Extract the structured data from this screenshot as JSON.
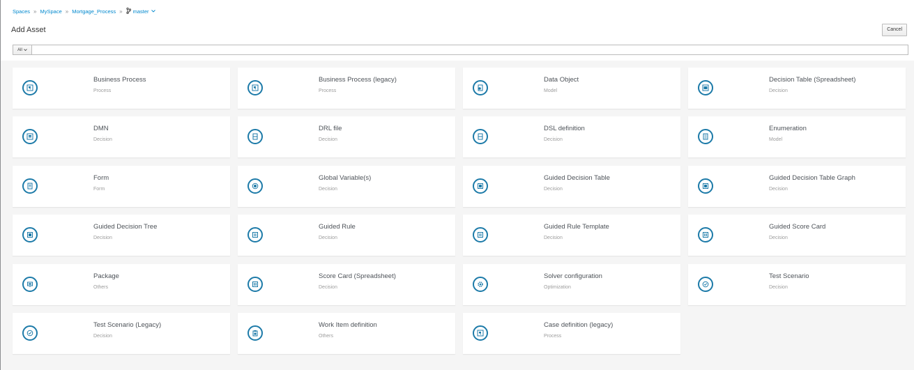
{
  "breadcrumb": {
    "items": [
      "Spaces",
      "MySpace",
      "Mortgage_Process"
    ],
    "separator": "»",
    "branch": "master"
  },
  "title": "Add Asset",
  "cancel_label": "Cancel",
  "filter": {
    "select_value": "All",
    "input_value": ""
  },
  "accent_color": "#1c7aa8",
  "link_color": "#0088ce",
  "assets": [
    {
      "title": "Business Process",
      "category": "Process",
      "icon": "process-icon"
    },
    {
      "title": "Business Process (legacy)",
      "category": "Process",
      "icon": "process-icon"
    },
    {
      "title": "Data Object",
      "category": "Model",
      "icon": "data-object-icon"
    },
    {
      "title": "Decision Table (Spreadsheet)",
      "category": "Decision",
      "icon": "spreadsheet-icon"
    },
    {
      "title": "DMN",
      "category": "Decision",
      "icon": "dmn-icon"
    },
    {
      "title": "DRL file",
      "category": "Decision",
      "icon": "file-icon"
    },
    {
      "title": "DSL definition",
      "category": "Decision",
      "icon": "file-icon"
    },
    {
      "title": "Enumeration",
      "category": "Model",
      "icon": "list-icon"
    },
    {
      "title": "Form",
      "category": "Form",
      "icon": "form-icon"
    },
    {
      "title": "Global Variable(s)",
      "category": "Decision",
      "icon": "globe-icon"
    },
    {
      "title": "Guided Decision Table",
      "category": "Decision",
      "icon": "table-icon"
    },
    {
      "title": "Guided Decision Table Graph",
      "category": "Decision",
      "icon": "table-icon"
    },
    {
      "title": "Guided Decision Tree",
      "category": "Decision",
      "icon": "table-icon"
    },
    {
      "title": "Guided Rule",
      "category": "Decision",
      "icon": "rule-icon"
    },
    {
      "title": "Guided Rule Template",
      "category": "Decision",
      "icon": "rule-icon"
    },
    {
      "title": "Guided Score Card",
      "category": "Decision",
      "icon": "scorecard-icon"
    },
    {
      "title": "Package",
      "category": "Others",
      "icon": "package-icon"
    },
    {
      "title": "Score Card (Spreadsheet)",
      "category": "Decision",
      "icon": "scorecard-icon"
    },
    {
      "title": "Solver configuration",
      "category": "Optimization",
      "icon": "gear-icon"
    },
    {
      "title": "Test Scenario",
      "category": "Decision",
      "icon": "check-icon"
    },
    {
      "title": "Test Scenario (Legacy)",
      "category": "Decision",
      "icon": "check-icon"
    },
    {
      "title": "Work Item definition",
      "category": "Others",
      "icon": "clipboard-icon"
    },
    {
      "title": "Case definition (legacy)",
      "category": "Process",
      "icon": "process-icon"
    }
  ]
}
